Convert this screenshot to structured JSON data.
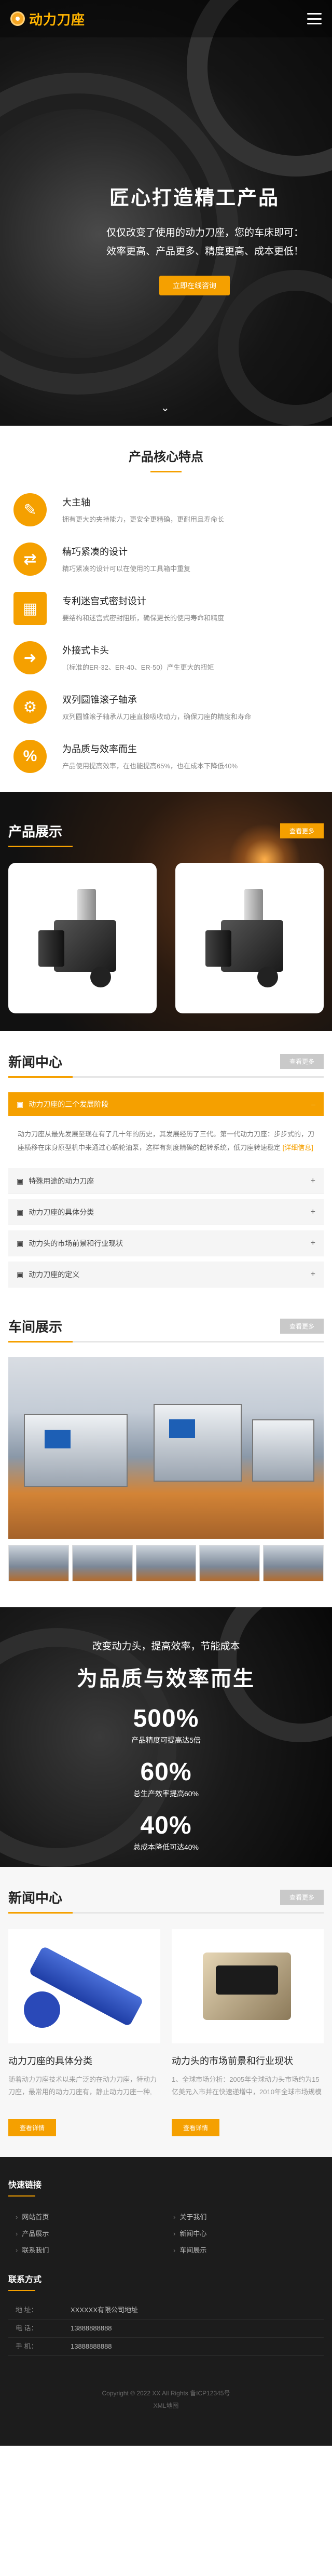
{
  "header": {
    "logo_text": "动力刀座",
    "menu_icon": "menu-icon"
  },
  "hero": {
    "title": "匠心打造精工产品",
    "lines": [
      "仅仅改变了使用的动力刀座，您的车床即可：",
      "效率更高、产品更多、精度更高、成本更低！"
    ],
    "button": "立即在线咨询",
    "scroll_icon": "chevron-down-icon"
  },
  "features": {
    "title": "产品核心特点",
    "items": [
      {
        "title": "大主轴",
        "desc": "拥有更大的夹持能力，更安全更精确，更耐用且寿命长",
        "icon": "lightbulb-icon"
      },
      {
        "title": "精巧紧凑的设计",
        "desc": "精巧紧凑的设计可以在使用的工具箱中重复",
        "icon": "arrows-icon"
      },
      {
        "title": "专利迷宫式密封设计",
        "desc": "要结构和迷宫式密封阻断，确保更长的使用寿命和精度",
        "icon": "grid-icon"
      },
      {
        "title": "外接式卡头",
        "desc": "（标准的ER-32、ER-40、ER-50）产生更大的扭矩",
        "icon": "arrow-right-icon"
      },
      {
        "title": "双列圆锥滚子轴承",
        "desc": "双列圆锥滚子轴承从刀座直接吸收动力，确保刀座的精度和寿命",
        "icon": "gears-icon"
      },
      {
        "title": "为品质与效率而生",
        "desc": "产品使用提高效率，在也能提高65%，也在成本下降低40%",
        "icon": "percent-icon"
      }
    ]
  },
  "products": {
    "title": "产品展示",
    "more": "查看更多"
  },
  "news": {
    "title": "新闻中心",
    "more": "查看更多",
    "active_title": "动力刀座的三个发展阶段",
    "active_body": "动力刀座从最先发展至现在有了几十年的历史，其发展经历了三代。第一代动力刀座：步步式的，刀座横移在床身原型机中来通过心蜗轮油泵，这样有刻度精确的起转系统，低刀座转速稳定",
    "active_more": "[详细信息]",
    "items": [
      "特殊用途的动力刀座",
      "动力刀座的具体分类",
      "动力头的市场前景和行业现状",
      "动力刀座的定义"
    ]
  },
  "workshop": {
    "title": "车间展示",
    "more": "查看更多"
  },
  "quality": {
    "subtitle": "改变动力头，提高效率，节能成本",
    "title": "为品质与效率而生",
    "stats": [
      {
        "value": "500%",
        "label": "产品精度可提高达5倍"
      },
      {
        "value": "60%",
        "label": "总生产效率提高60%"
      },
      {
        "value": "40%",
        "label": "总成本降低可达40%"
      }
    ]
  },
  "news2": {
    "title": "新闻中心",
    "more": "查看更多",
    "cards": [
      {
        "title": "动力刀座的具体分类",
        "desc": "随着动力刀座技术以来广泛的在动力刀座，特动力刀座，最常用的动力刀座有，静止动力刀座一种,",
        "button": "查看详情"
      },
      {
        "title": "动力头的市场前景和行业现状",
        "desc": "1、全球市场分析：2005年全球动力头市场约为15亿美元入市并在快速递增中，2010年全球市场规模",
        "button": "查看详情"
      }
    ]
  },
  "footer": {
    "links_title": "快速链接",
    "links": [
      "网站首页",
      "关于我们",
      "产品展示",
      "新闻中心",
      "联系我们",
      "车间展示"
    ],
    "contact_title": "联系方式",
    "contact": [
      {
        "label": "地 址：",
        "value": "XXXXXX有限公司地址"
      },
      {
        "label": "电 话：",
        "value": "13888888888"
      },
      {
        "label": "手 机：",
        "value": "13888888888"
      }
    ],
    "copyright": "Copyright © 2022 XX All Rights 备ICP12345号",
    "sitemap": "XML地图"
  }
}
